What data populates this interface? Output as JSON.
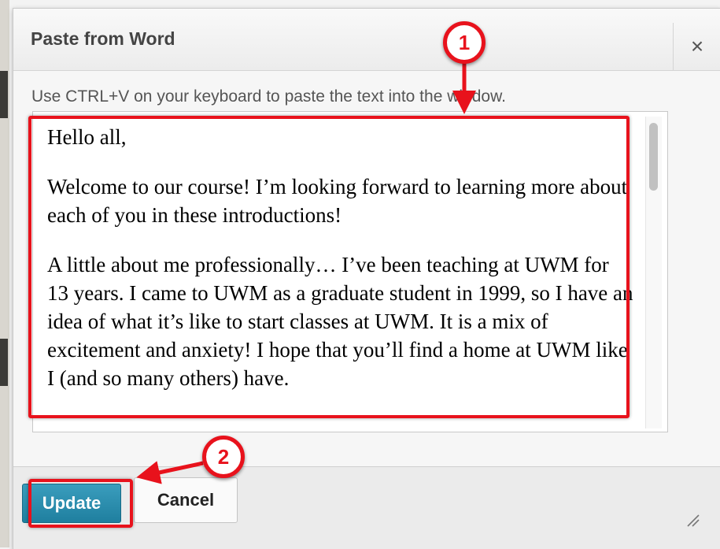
{
  "dialog": {
    "title": "Paste from Word",
    "close_label": "×",
    "instruction": "Use CTRL+V on your keyboard to paste the text into the window."
  },
  "editor": {
    "paragraphs": [
      "Hello all,",
      "Welcome to our course!  I’m looking forward to learning more about each of you in these introductions!",
      "A little about me professionally…  I’ve been teaching at UWM for 13 years.  I came to UWM as a graduate student in 1999, so I have an idea of what it’s like to start classes at UWM.  It is a mix of excitement and anxiety!  I hope that you’ll find a home at UWM like I (and so many others) have."
    ]
  },
  "buttons": {
    "update_label": "Update",
    "cancel_label": "Cancel"
  },
  "callouts": {
    "step1": "1",
    "step2": "2"
  },
  "colors": {
    "highlight": "#e8121c",
    "update_button": "#2a8fb0"
  }
}
